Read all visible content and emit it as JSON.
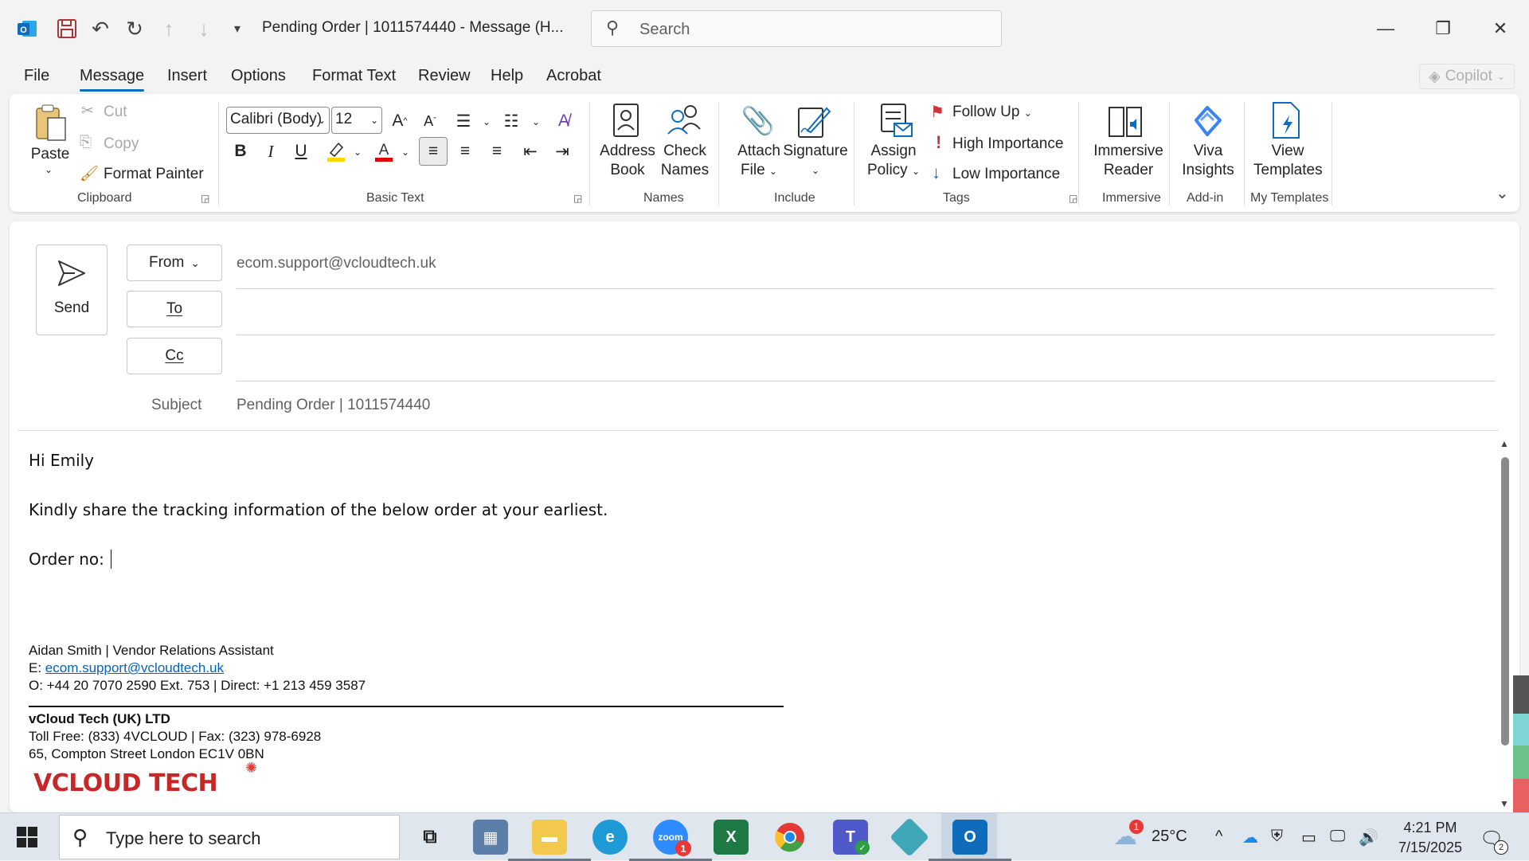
{
  "window": {
    "title": "Pending Order |  1011574440  -  Message (H...",
    "search_placeholder": "Search"
  },
  "menu": {
    "tabs": [
      "File",
      "Message",
      "Insert",
      "Options",
      "Format Text",
      "Review",
      "Help",
      "Acrobat"
    ],
    "active": "Message",
    "copilot_label": "Copilot"
  },
  "ribbon": {
    "clipboard": {
      "group_label": "Clipboard",
      "paste_label": "Paste",
      "cut_label": "Cut",
      "copy_label": "Copy",
      "format_painter_label": "Format Painter"
    },
    "basic_text": {
      "group_label": "Basic Text",
      "font_name": "Calibri (Body)",
      "font_size": "12",
      "bold": "B",
      "italic": "I",
      "underline": "U",
      "font_color_letter": "A",
      "highlight_color": "#ffd800",
      "font_color": "#e00000"
    },
    "names": {
      "group_label": "Names",
      "address_book_l1": "Address",
      "address_book_l2": "Book",
      "check_names_l1": "Check",
      "check_names_l2": "Names"
    },
    "include": {
      "group_label": "Include",
      "attach_l1": "Attach",
      "attach_l2": "File",
      "signature_l1": "Signature"
    },
    "tags": {
      "group_label": "Tags",
      "assign_l1": "Assign",
      "assign_l2": "Policy",
      "follow_up": "Follow Up",
      "high_importance": "High Importance",
      "low_importance": "Low Importance"
    },
    "immersive": {
      "group_label": "Immersive",
      "l1": "Immersive",
      "l2": "Reader"
    },
    "addin": {
      "group_label": "Add-in",
      "l1": "Viva",
      "l2": "Insights"
    },
    "templates": {
      "group_label": "My Templates",
      "l1": "View",
      "l2": "Templates"
    }
  },
  "compose": {
    "send_label": "Send",
    "from_label": "From",
    "from_value": "ecom.support@vcloudtech.uk",
    "to_label": "To",
    "to_value": "",
    "cc_label": "Cc",
    "cc_value": "",
    "subject_label": "Subject",
    "subject_value": "Pending Order |  1011574440"
  },
  "body": {
    "greeting": "Hi Emily",
    "line1": "Kindly share the tracking information of the below order at your earliest.",
    "line2": "Order no: ",
    "signature": {
      "name_line": "Aidan Smith | Vendor Relations Assistant",
      "email_prefix": "E: ",
      "email": "ecom.support@vcloudtech.uk",
      "phone_line": "O:  +44 20 7070 2590 Ext. 753 | Direct: +1 213 459 3587",
      "company": "vCloud Tech (UK) LTD",
      "toll_line": "Toll Free: (833) 4VCLOUD | Fax: (323) 978-6928",
      "address_line": "65, Compton Street London EC1V 0BN",
      "logo_text": "VCLOUD TECH"
    }
  },
  "taskbar": {
    "search_placeholder": "Type here to search",
    "zoom_badge": "1",
    "weather_badge": "1",
    "temperature": "25°C",
    "time": "4:21 PM",
    "date": "7/15/2025",
    "notification_count": "2"
  }
}
